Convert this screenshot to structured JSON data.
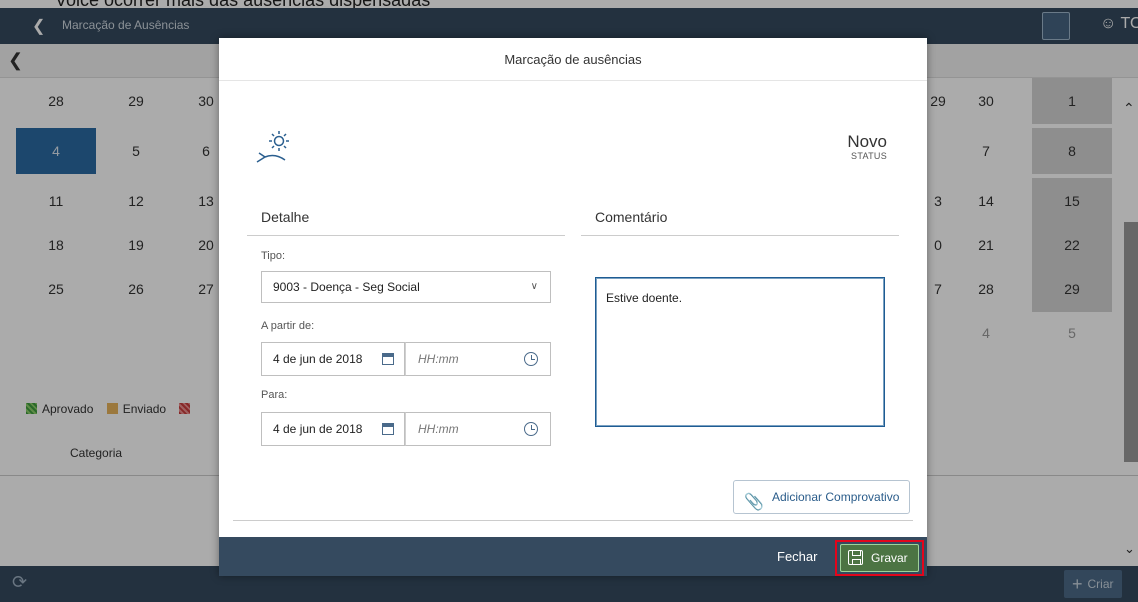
{
  "background": {
    "top_strip_text": "Voice ocorrer mais das ausencias dispensadas",
    "app_title": "Marcação de Ausências",
    "user_label": "TO",
    "calendar": {
      "rows": [
        {
          "cells": [
            "28",
            "29",
            "30",
            "29",
            "30",
            "1"
          ]
        },
        {
          "cells": [
            "4",
            "5",
            "6",
            "",
            "7",
            "8"
          ]
        },
        {
          "cells": [
            "11",
            "12",
            "13",
            "3",
            "14",
            "15"
          ]
        },
        {
          "cells": [
            "18",
            "19",
            "20",
            "0",
            "21",
            "22"
          ]
        },
        {
          "cells": [
            "25",
            "26",
            "27",
            "7",
            "28",
            "29"
          ]
        },
        {
          "cells": [
            "",
            "",
            "",
            "",
            "4",
            "5"
          ]
        }
      ]
    },
    "legend": {
      "approved": "Aprovado",
      "sent": "Enviado"
    },
    "category_header": "Categoria",
    "create_label": "Criar"
  },
  "dialog": {
    "title": "Marcação de ausências",
    "icon": "vacation-sun-icon",
    "status_value": "Novo",
    "status_label": "STATUS",
    "detail_title": "Detalhe",
    "comment_title": "Comentário",
    "type_label": "Tipo:",
    "type_value": "9003 - Doença - Seg Social",
    "from_label": "A partir de:",
    "from_date": "4 de jun de 2018",
    "from_time_placeholder": "HH:mm",
    "to_label": "Para:",
    "to_date": "4 de jun de 2018",
    "to_time_placeholder": "HH:mm",
    "comment_text": "Estive doente.",
    "attach_label": "Adicionar Comprovativo",
    "close_label": "Fechar",
    "save_label": "Gravar"
  },
  "colors": {
    "shell": "#354a5f",
    "today": "#2a6aa3",
    "save_button": "#4c7443",
    "highlight": "#e3051b"
  }
}
